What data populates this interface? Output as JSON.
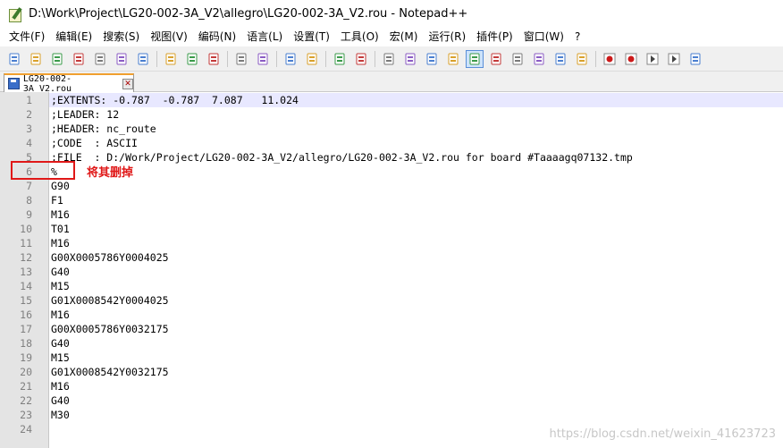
{
  "window": {
    "title": "D:\\Work\\Project\\LG20-002-3A_V2\\allegro\\LG20-002-3A_V2.rou - Notepad++"
  },
  "menu": [
    "文件(F)",
    "编辑(E)",
    "搜索(S)",
    "视图(V)",
    "编码(N)",
    "语言(L)",
    "设置(T)",
    "工具(O)",
    "宏(M)",
    "运行(R)",
    "插件(P)",
    "窗口(W)",
    "?"
  ],
  "toolbar": {
    "icons": [
      "new-file-icon",
      "open-file-icon",
      "save-icon",
      "save-all-icon",
      "close-icon",
      "close-all-icon",
      "print-icon",
      "cut-icon",
      "copy-icon",
      "paste-icon",
      "undo-icon",
      "redo-icon",
      "find-icon",
      "replace-icon",
      "zoom-in-icon",
      "zoom-out-icon",
      "sync-vertical-icon",
      "sync-horizontal-icon",
      "word-wrap-icon",
      "show-all-chars-icon",
      "indent-guide-icon",
      "udl-icon",
      "doc-map-icon",
      "function-list-icon",
      "folder-workspace-icon",
      "monitor-icon",
      "record-macro-icon",
      "stop-record-icon",
      "play-macro-icon",
      "run-multiple-icon",
      "save-macro-icon"
    ],
    "active": "indent-guide-icon"
  },
  "tab": {
    "label": "LG20-002-3A_V2.rou"
  },
  "editor": {
    "current_line": 1,
    "lines": [
      ";EXTENTS: -0.787  -0.787  7.087   11.024",
      ";LEADER: 12",
      ";HEADER: nc_route",
      ";CODE  : ASCII",
      ";FILE  : D:/Work/Project/LG20-002-3A_V2/allegro/LG20-002-3A_V2.rou for board #Taaaagq07132.tmp",
      "%",
      "G90",
      "F1",
      "M16",
      "T01",
      "M16",
      "G00X0005786Y0004025",
      "G40",
      "M15",
      "G01X0008542Y0004025",
      "M16",
      "G00X0005786Y0032175",
      "G40",
      "M15",
      "G01X0008542Y0032175",
      "M16",
      "G40",
      "M30",
      ""
    ]
  },
  "annotation": {
    "text": "将其删掉",
    "color": "#e01818"
  },
  "watermark": "https://blog.csdn.net/weixin_41623723",
  "colors": {
    "gutter": "#e4e4e4",
    "current_line": "#e8e8ff",
    "tab_accent": "#f0a030"
  }
}
